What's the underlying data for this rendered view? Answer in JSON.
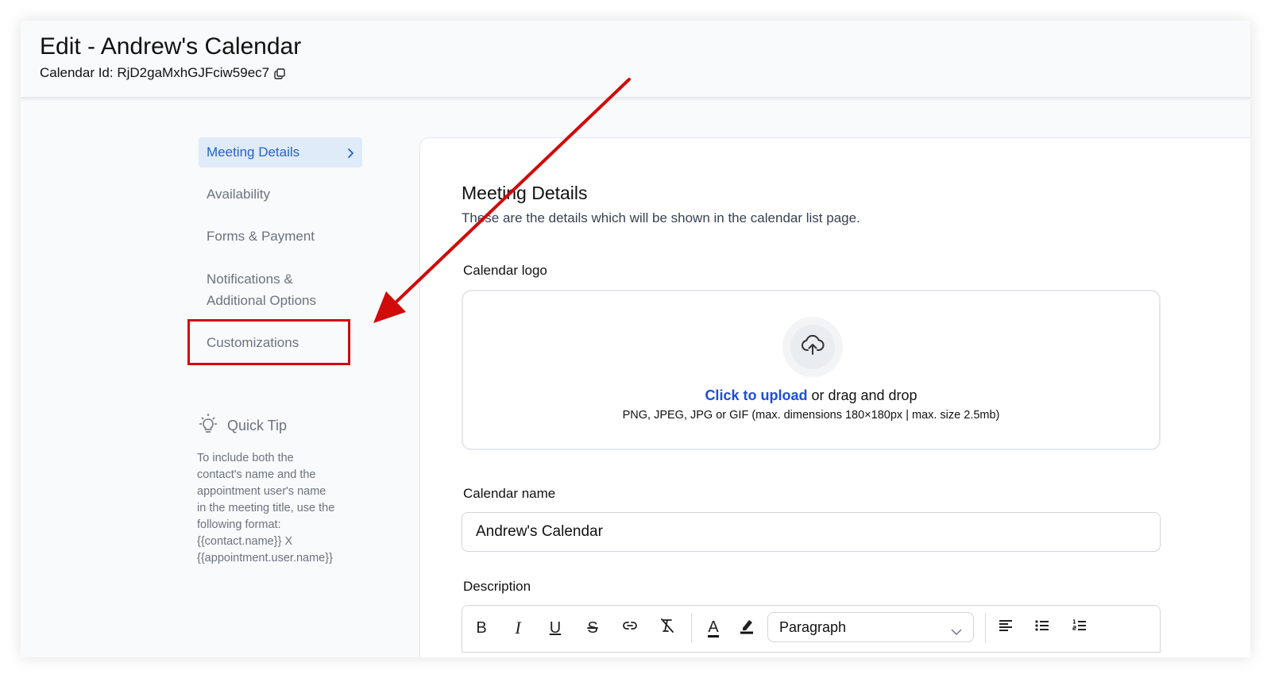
{
  "header": {
    "title": "Edit - Andrew's Calendar",
    "calendar_id_label": "Calendar Id: RjD2gaMxhGJFciw59ec7"
  },
  "sidebar": {
    "items": [
      {
        "label": "Meeting Details",
        "active": true
      },
      {
        "label": "Availability"
      },
      {
        "label": "Forms & Payment"
      },
      {
        "label": "Notifications &\nAdditional Options"
      },
      {
        "label": "Customizations"
      }
    ]
  },
  "quick_tip": {
    "title": "Quick Tip",
    "text": "To include both the\ncontact's name and the\nappointment user's name\nin the meeting title, use the\nfollowing format:\n{{contact.name}} X\n{{appointment.user.name}}"
  },
  "main": {
    "section_title": "Meeting Details",
    "section_subtitle": "These are the details which will be shown in the calendar list page.",
    "logo_label": "Calendar logo",
    "upload_link": "Click to upload",
    "upload_rest": " or drag and drop",
    "upload_hint": "PNG, JPEG, JPG or GIF (max. dimensions 180×180px | max. size 2.5mb)",
    "name_label": "Calendar name",
    "name_value": "Andrew's Calendar",
    "description_label": "Description",
    "toolbar": {
      "bold": "B",
      "italic": "I",
      "underline": "U",
      "strike": "S",
      "text_color": "A",
      "paragraph_value": "Paragraph"
    }
  },
  "colors": {
    "accent": "#2563c4",
    "active_bg": "#e0ebf9",
    "annotation_red": "#d10a0a",
    "link_blue": "#1d4ed8"
  }
}
